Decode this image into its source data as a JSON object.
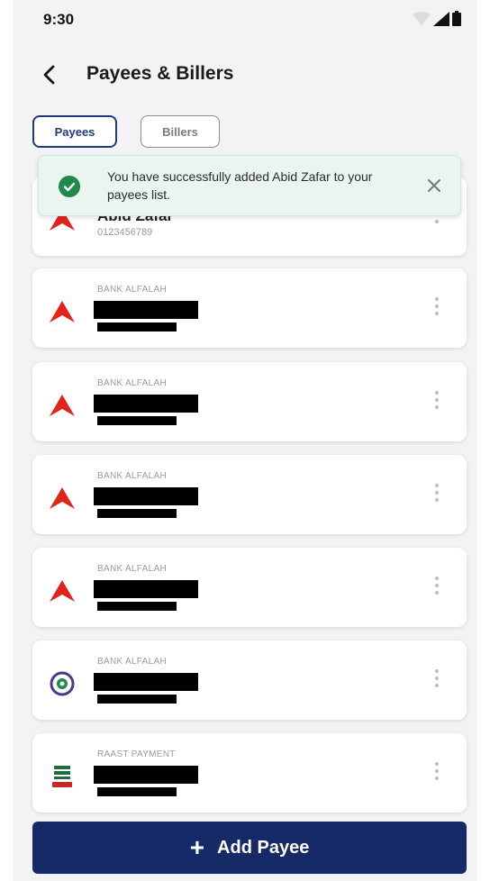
{
  "status_bar": {
    "time": "9:30"
  },
  "header": {
    "title": "Payees & Billers"
  },
  "tabs": [
    {
      "label": "Payees",
      "active": true
    },
    {
      "label": "Billers",
      "active": false
    }
  ],
  "toast": {
    "message": "You have successfully added Abid Zafar to your payees list.",
    "icon": "check-circle-icon",
    "close_icon": "close-icon"
  },
  "payees": [
    {
      "name": "Abid Zafar",
      "account": "0123456789",
      "logo": "bank-alfalah-logo"
    },
    {
      "bank": "BANK ALFALAH",
      "name_redacted": true,
      "logo": "bank-alfalah-logo"
    },
    {
      "bank": "BANK ALFALAH",
      "name_redacted": true,
      "logo": "bank-alfalah-logo"
    },
    {
      "bank": "BANK ALFALAH",
      "name_redacted": true,
      "logo": "bank-alfalah-logo"
    },
    {
      "bank": "BANK ALFALAH",
      "name_redacted": true,
      "logo": "bank-alfalah-logo"
    },
    {
      "bank": "BANK ALFALAH",
      "name_redacted": true,
      "logo": "circular-bank-logo"
    },
    {
      "bank": "RAAST PAYMENT",
      "name_redacted": true,
      "logo": "raast-logo"
    }
  ],
  "add_button": {
    "label": "Add Payee"
  },
  "colors": {
    "primary": "#172a68",
    "accent_blue": "#1f3a7a",
    "alfalah_red": "#e2231a",
    "success_green": "#1e8a4c",
    "toast_bg": "#e9f5ee"
  }
}
